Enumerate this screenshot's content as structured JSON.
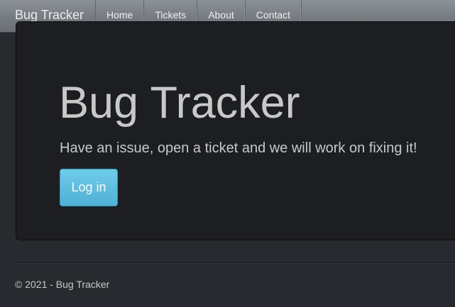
{
  "navbar": {
    "brand": "Bug Tracker",
    "items": [
      {
        "label": "Home"
      },
      {
        "label": "Tickets"
      },
      {
        "label": "About"
      },
      {
        "label": "Contact"
      }
    ]
  },
  "hero": {
    "title": "Bug Tracker",
    "lead": "Have an issue, open a ticket and we will work on fixing it!",
    "login_label": "Log in"
  },
  "footer": {
    "text": "© 2021 - Bug Tracker"
  },
  "colors": {
    "background": "#272b30",
    "jumbotron": "#1c1e22",
    "accent": "#5bc0de"
  }
}
